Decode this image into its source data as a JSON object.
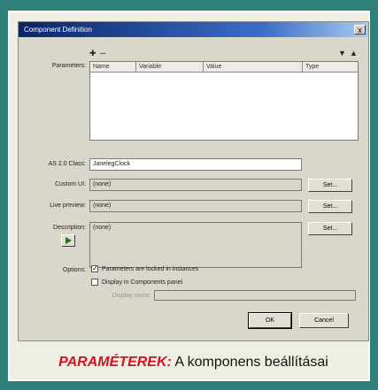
{
  "dialog": {
    "title": "Component Definition",
    "close_label": "x",
    "param_toolbar": {
      "add_icon": "plus-icon",
      "remove_icon": "minus-icon",
      "move_down_icon": "arrow-down-icon",
      "move_up_icon": "arrow-up-icon"
    },
    "labels": {
      "parameters": "Parameters:",
      "as2_class": "AS 2.0 Class:",
      "custom_ui": "Custom UI:",
      "live_preview": "Live preview:",
      "description": "Description:",
      "options": "Options:",
      "display_name": "Display name:"
    },
    "table": {
      "columns": [
        "Name",
        "Variable",
        "Value",
        "Type"
      ]
    },
    "fields": {
      "as2_class": "JanelegClock",
      "custom_ui": "(none)",
      "live_preview": "(none)",
      "description": "(none)",
      "display_name": ""
    },
    "set_button_label": "Set...",
    "options": {
      "locked": "Parameters are locked in instances",
      "display_in_panel": "Display in Components panel"
    },
    "ok_label": "OK",
    "cancel_label": "Cancel"
  },
  "caption": {
    "highlight": "PARAMÉTEREK:",
    "text": " A komponens beállításai"
  },
  "colors": {
    "background": "#2f7f7b",
    "frame": "#efeee4",
    "caption_highlight": "#d5121f",
    "titlebar": "#0a246a"
  }
}
